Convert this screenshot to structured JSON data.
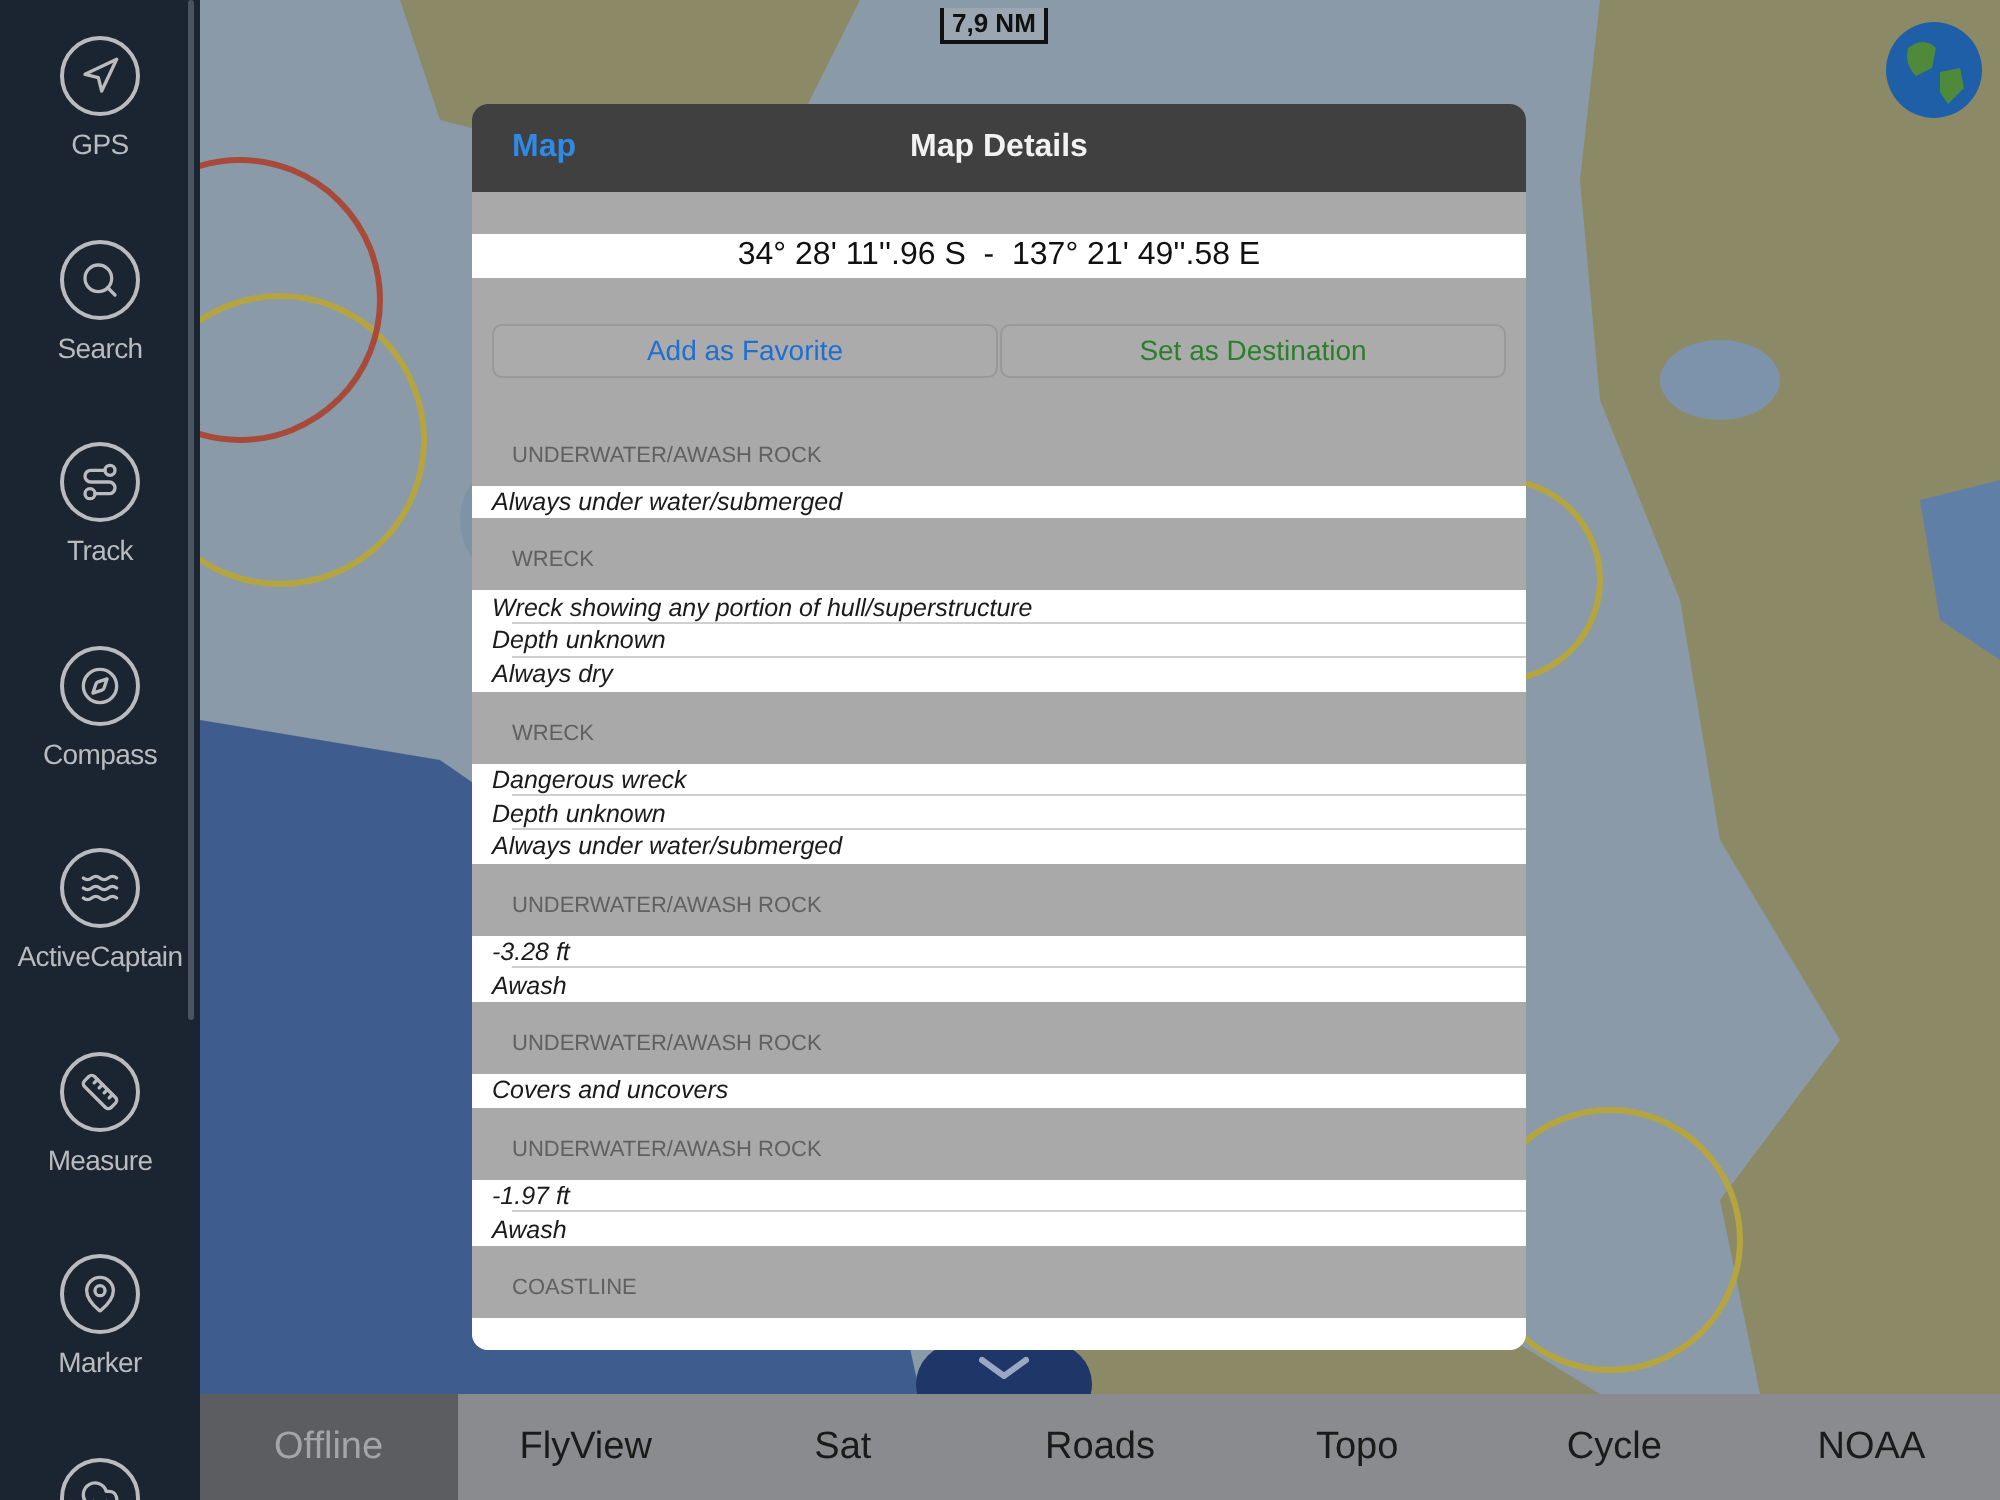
{
  "sidebar": {
    "items": [
      {
        "kind": "gps",
        "label": "GPS"
      },
      {
        "kind": "search",
        "label": "Search"
      },
      {
        "kind": "track",
        "label": "Track"
      },
      {
        "kind": "compass",
        "label": "Compass"
      },
      {
        "kind": "activecaptain",
        "label": "ActiveCaptain"
      },
      {
        "kind": "measure",
        "label": "Measure"
      },
      {
        "kind": "marker",
        "label": "Marker"
      },
      {
        "kind": "weather"
      }
    ]
  },
  "map": {
    "kind": "picture",
    "scale_bar": "7,9 NM"
  },
  "dialog": {
    "back": "Map",
    "title": "Map Details",
    "coordinates": "34° 28' 11''.96 S  -  137° 21' 49''.58 E",
    "actions": [
      {
        "kind": "favorite",
        "label": "Add as Favorite"
      },
      {
        "kind": "destination",
        "label": "Set as Destination"
      }
    ],
    "sections": [
      {
        "title": "UNDERWATER/AWASH ROCK",
        "rows": [
          "Always under water/submerged"
        ]
      },
      {
        "title": "WRECK",
        "rows": [
          "Wreck showing any portion of hull/superstructure",
          "Depth unknown",
          "Always dry"
        ]
      },
      {
        "title": "WRECK",
        "rows": [
          "Dangerous wreck",
          "Depth unknown",
          "Always under water/submerged"
        ]
      },
      {
        "title": "UNDERWATER/AWASH ROCK",
        "rows": [
          "-3.28 ft",
          "Awash"
        ]
      },
      {
        "title": "UNDERWATER/AWASH ROCK",
        "rows": [
          "Covers and uncovers"
        ]
      },
      {
        "title": "UNDERWATER/AWASH ROCK",
        "rows": [
          "-1.97 ft",
          "Awash"
        ]
      },
      {
        "title": "COASTLINE"
      }
    ]
  },
  "map_types": [
    {
      "label": "Offline",
      "selected": true
    },
    {
      "label": "FlyView",
      "selected": false
    },
    {
      "label": "Sat",
      "selected": false
    },
    {
      "label": "Roads",
      "selected": false
    },
    {
      "label": "Topo",
      "selected": false
    },
    {
      "label": "Cycle",
      "selected": false
    },
    {
      "label": "NOAA",
      "selected": false
    }
  ]
}
